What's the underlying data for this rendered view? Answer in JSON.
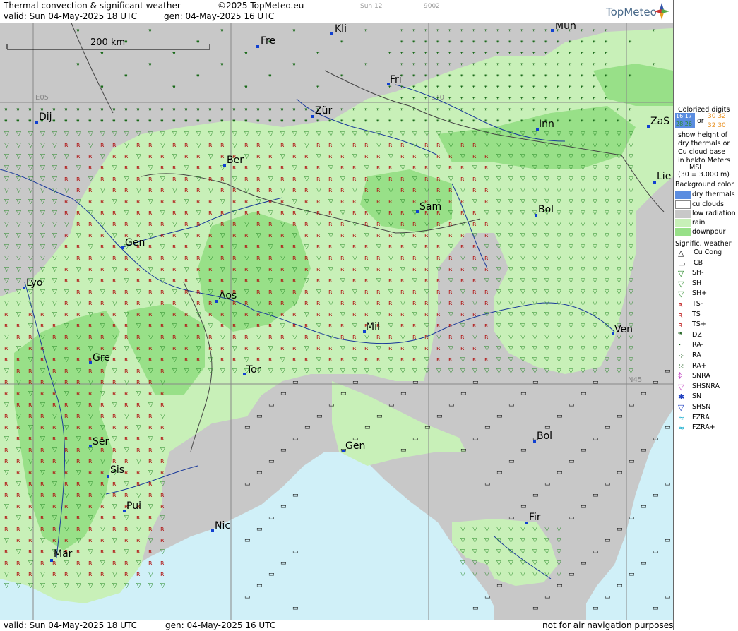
{
  "header": {
    "title": "Thermal convection & significant weather",
    "copyright": "©2025 TopMeteo.eu",
    "sun": "Sun 12",
    "code": "9002",
    "valid": "valid:  Sun  04-May-2025  18 UTC",
    "gen": "gen: 04-May-2025 16 UTC",
    "logo": "TopMeteo"
  },
  "footer": {
    "valid": "valid:  Sun  04-May-2025  18 UTC",
    "gen": "gen: 04-May-2025 16 UTC",
    "disclaimer": "not for air navigation purposes"
  },
  "map": {
    "scale_label": "200 km",
    "grid_labels": [
      "E05",
      "E10",
      "N45"
    ],
    "cities": [
      "Kli",
      "Mun",
      "Fre",
      "Fri",
      "Dij",
      "Zür",
      "Inn",
      "ZaS",
      "Ber",
      "Lie",
      "Sam",
      "Bol",
      "Gen",
      "Lyo",
      "Aos",
      "Mil",
      "Ven",
      "Gre",
      "Tor",
      "Gen",
      "Bol",
      "Ser",
      "Sis",
      "Pui",
      "Nic",
      "Fir",
      "Mar"
    ],
    "colors": {
      "sea": "#d0f0f8",
      "low_radiation": "#c8c8c8",
      "rain": "#c8f0b8",
      "downpour": "#98e088",
      "dry_thermals": "#5b8de0",
      "border": "#444",
      "river": "#1a3a9a"
    }
  },
  "legend": {
    "title": "Colorized digits",
    "sample_a": [
      "16 17",
      "28 26"
    ],
    "sample_b": [
      "30 32",
      "32 30"
    ],
    "or": "or",
    "desc": [
      "show height of",
      "dry thermals or",
      "Cu cloud base",
      "in hekto Meters",
      "MSL",
      "(30 = 3.000 m)"
    ],
    "bg_title": "Background color",
    "bg_items": [
      "dry thermals",
      "cu clouds",
      "low radiation",
      "rain",
      "downpour"
    ],
    "sig_title": "Signific. weather",
    "sig_items": [
      "Cu Cong",
      "CB",
      "SH-",
      "SH",
      "SH+",
      "TS-",
      "TS",
      "TS+",
      "DZ",
      "RA-",
      "RA",
      "RA+",
      "SNRA",
      "SHSNRA",
      "SN",
      "SHSN",
      "FZRA",
      "FZRA+"
    ]
  }
}
